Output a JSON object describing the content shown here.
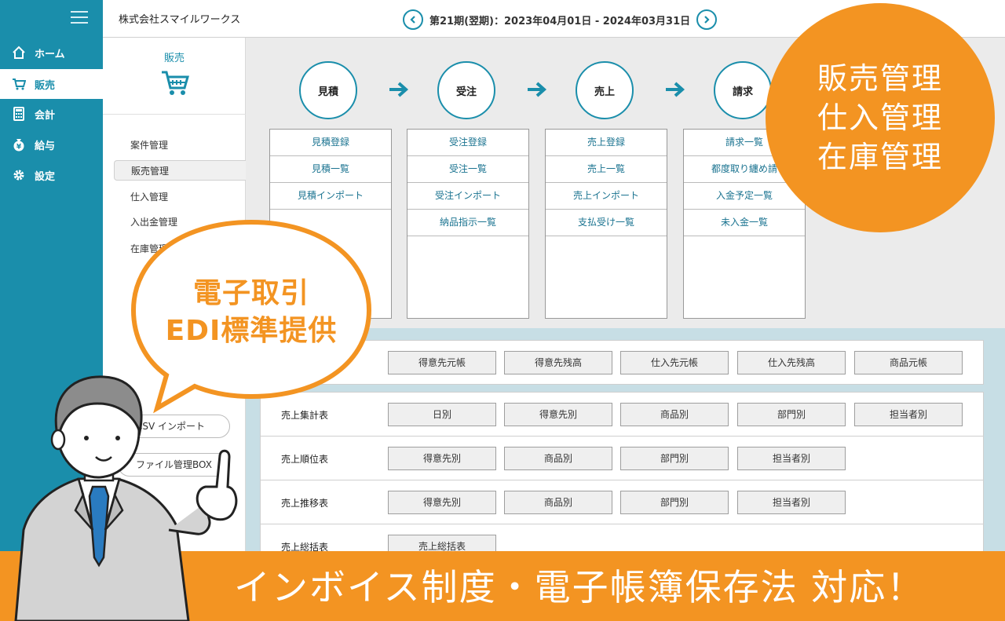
{
  "header": {
    "company": "株式会社スマイルワークス",
    "period": "第21期(翌期)：2023年04月01日 - 2024年03月31日"
  },
  "sidebar": {
    "items": [
      {
        "label": "ホーム",
        "icon": "home-icon"
      },
      {
        "label": "販売",
        "icon": "cart-icon"
      },
      {
        "label": "会計",
        "icon": "calculator-icon"
      },
      {
        "label": "給与",
        "icon": "money-bag-icon"
      },
      {
        "label": "設定",
        "icon": "gear-icon"
      }
    ]
  },
  "submenu": {
    "title": "販売",
    "items": [
      "案件管理",
      "販売管理",
      "仕入管理",
      "入出金管理",
      "在庫管理"
    ],
    "pills": [
      "CSV インポート",
      "ファイル管理BOX"
    ]
  },
  "flow": {
    "steps": [
      "見積",
      "受注",
      "売上",
      "請求"
    ],
    "columns": [
      [
        "見積登録",
        "見積一覧",
        "見積インポート"
      ],
      [
        "受注登録",
        "受注一覧",
        "受注インポート",
        "納品指示一覧"
      ],
      [
        "売上登録",
        "売上一覧",
        "売上インポート",
        "支払受け一覧"
      ],
      [
        "請求一覧",
        "都度取り纏め請",
        "入金予定一覧",
        "未入金一覧"
      ]
    ]
  },
  "ledger": {
    "buttons": [
      "得意先元帳",
      "得意先残高",
      "仕入先元帳",
      "仕入先残高",
      "商品元帳"
    ]
  },
  "reports": [
    {
      "label": "売上集計表",
      "buttons": [
        "日別",
        "得意先別",
        "商品別",
        "部門別",
        "担当者別"
      ]
    },
    {
      "label": "売上順位表",
      "buttons": [
        "得意先別",
        "商品別",
        "部門別",
        "担当者別"
      ]
    },
    {
      "label": "売上推移表",
      "buttons": [
        "得意先別",
        "商品別",
        "部門別",
        "担当者別"
      ]
    },
    {
      "label": "売上総括表",
      "buttons": [
        "売上総括表"
      ]
    }
  ],
  "callout": {
    "circle_lines": [
      "販売管理",
      "仕入管理",
      "在庫管理"
    ],
    "bubble_lines": [
      "電子取引",
      "EDI標準提供"
    ],
    "banner": "インボイス制度・電子帳簿保存法 対応！"
  },
  "colors": {
    "teal": "#1a8eab",
    "orange": "#f39422"
  }
}
